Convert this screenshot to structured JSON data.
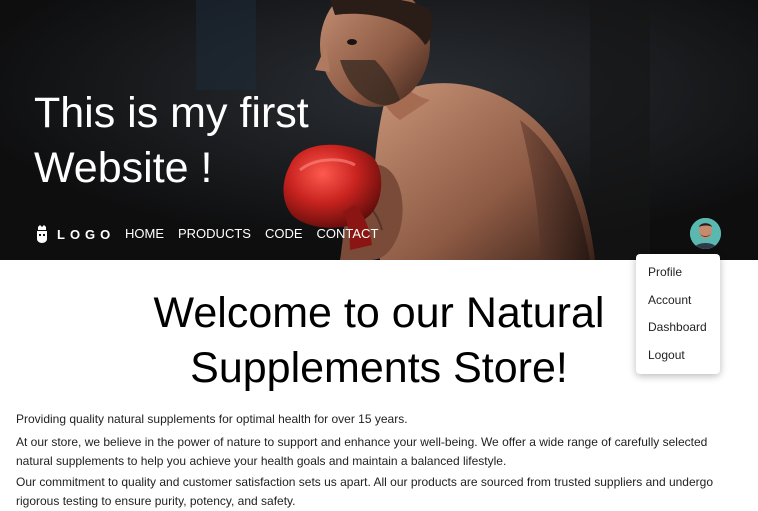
{
  "hero": {
    "title_line1": "This is my first",
    "title_line2": "Website !"
  },
  "nav": {
    "logo_text": "LOGO",
    "links": [
      "HOME",
      "PRODUCTS",
      "CODE",
      "CONTACT"
    ]
  },
  "user_menu": {
    "items": [
      "Profile",
      "Account",
      "Dashboard",
      "Logout"
    ]
  },
  "main": {
    "heading_line1": "Welcome to our Natural",
    "heading_line2": "Supplements Store!",
    "paragraphs": [
      "Providing quality natural supplements for optimal health for over 15 years.",
      "At our store, we believe in the power of nature to support and enhance your well-being. We offer a wide range of carefully selected natural supplements to help you achieve your health goals and maintain a balanced lifestyle.",
      "Our commitment to quality and customer satisfaction sets us apart. All our products are sourced from trusted suppliers and undergo rigorous testing to ensure purity, potency, and safety."
    ]
  },
  "colors": {
    "hero_bg": "#121212",
    "avatar_bg": "#5bb8b0",
    "glove_red": "#c8231f"
  }
}
